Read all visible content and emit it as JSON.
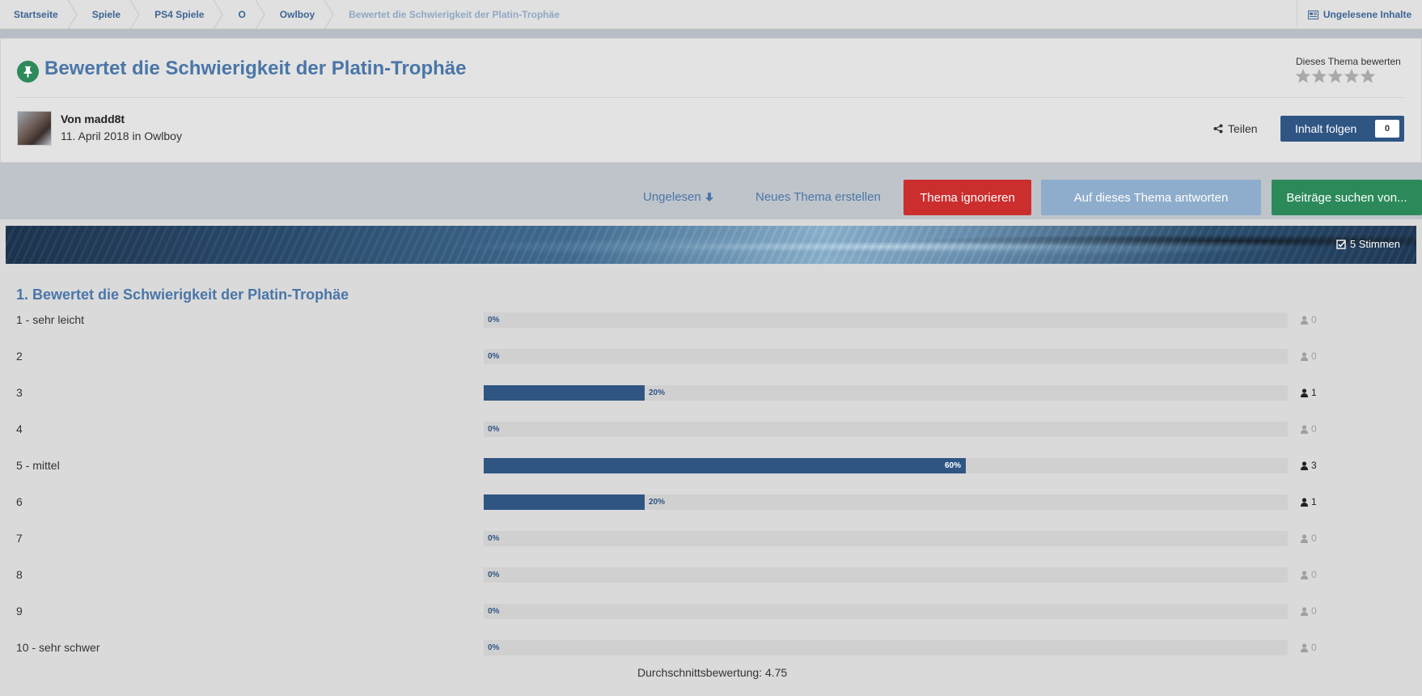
{
  "breadcrumb": [
    {
      "label": "Startseite"
    },
    {
      "label": "Spiele"
    },
    {
      "label": "PS4 Spiele"
    },
    {
      "label": "O"
    },
    {
      "label": "Owlboy"
    },
    {
      "label": "Bewertet die Schwierigkeit der Platin-Trophäe"
    }
  ],
  "unread_content_label": "Ungelesene Inhalte",
  "topic": {
    "title": "Bewertet die Schwierigkeit der Platin-Trophäe",
    "rate_label": "Dieses Thema bewerten",
    "author": "Von madd8t",
    "date_line": "11. April 2018 in Owlboy",
    "share_label": "Teilen",
    "follow_label": "Inhalt folgen",
    "follow_count": "0"
  },
  "actions": {
    "unread": "Ungelesen",
    "new_topic": "Neues Thema erstellen",
    "ignore": "Thema ignorieren",
    "reply": "Auf dieses Thema antworten",
    "search_posts": "Beiträge suchen von..."
  },
  "poll": {
    "votes_label": "5 Stimmen",
    "question": "1. Bewertet die Schwierigkeit der Platin-Trophäe",
    "options": [
      {
        "label": "1 - sehr leicht",
        "percent": 0,
        "percent_label": "0%",
        "votes": "0"
      },
      {
        "label": "2",
        "percent": 0,
        "percent_label": "0%",
        "votes": "0"
      },
      {
        "label": "3",
        "percent": 20,
        "percent_label": "20%",
        "votes": "1"
      },
      {
        "label": "4",
        "percent": 0,
        "percent_label": "0%",
        "votes": "0"
      },
      {
        "label": "5 - mittel",
        "percent": 60,
        "percent_label": "60%",
        "votes": "3"
      },
      {
        "label": "6",
        "percent": 20,
        "percent_label": "20%",
        "votes": "1"
      },
      {
        "label": "7",
        "percent": 0,
        "percent_label": "0%",
        "votes": "0"
      },
      {
        "label": "8",
        "percent": 0,
        "percent_label": "0%",
        "votes": "0"
      },
      {
        "label": "9",
        "percent": 0,
        "percent_label": "0%",
        "votes": "0"
      },
      {
        "label": "10 - sehr schwer",
        "percent": 0,
        "percent_label": "0%",
        "votes": "0"
      }
    ],
    "average": "Durchschnittsbewertung: 4.75"
  },
  "colors": {
    "link_blue": "#4a76a8",
    "bar_fill": "#2f5583",
    "ignore_red": "#cc2e2e",
    "reply_light_blue": "#8eadcc",
    "search_green": "#2c8a5a",
    "pin_green": "#2f8a5b"
  },
  "icons": [
    "pin-icon",
    "star-icon",
    "share-icon",
    "arrow-down-icon",
    "check-square-icon",
    "user-icon",
    "newspaper-icon"
  ]
}
